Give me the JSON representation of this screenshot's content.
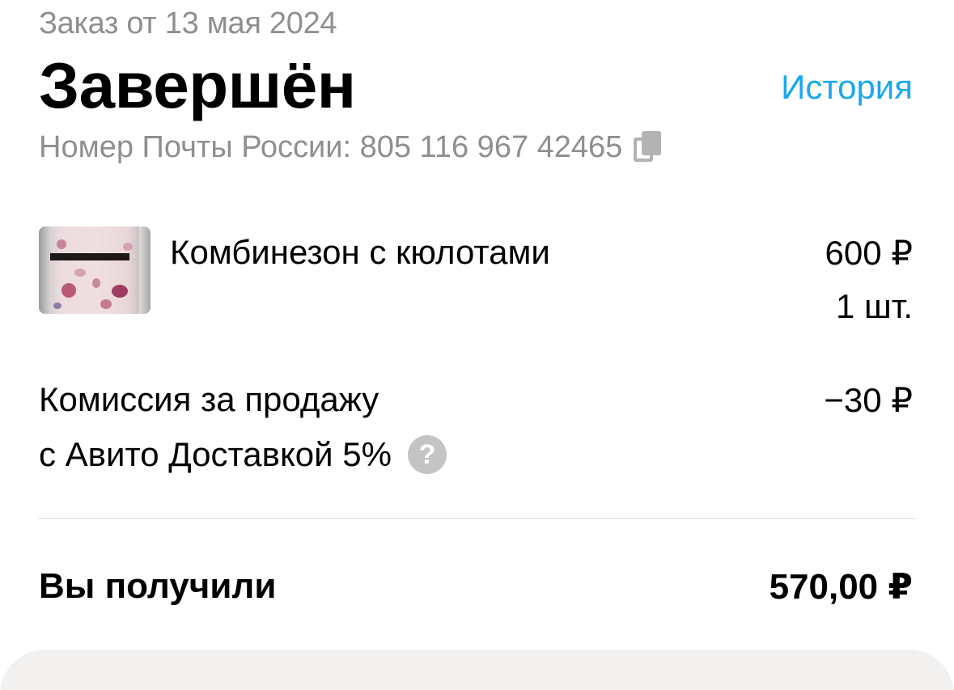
{
  "order": {
    "date_label": "Заказ от 13 мая 2024",
    "status": "Завершён",
    "history_link": "История",
    "tracking_label": "Номер Почты России: 805 116 967 42465",
    "copy_icon": "copy-icon"
  },
  "item": {
    "image_icon": "product-thumbnail",
    "name": "Комбинезон с кюлотами",
    "price": "600 ₽",
    "quantity": "1 шт."
  },
  "commission": {
    "line1": "Комиссия за продажу",
    "line2": "с Авито Доставкой 5%",
    "help_glyph": "?",
    "value": "−30 ₽"
  },
  "total": {
    "label": "Вы получили",
    "value": "570,00 ₽"
  },
  "colors": {
    "accent_link": "#1aa8f0",
    "secondary_text": "#8f8f8f",
    "help_icon_bg": "#c4c4c4",
    "bottom_card_bg": "#f2f1f0"
  }
}
